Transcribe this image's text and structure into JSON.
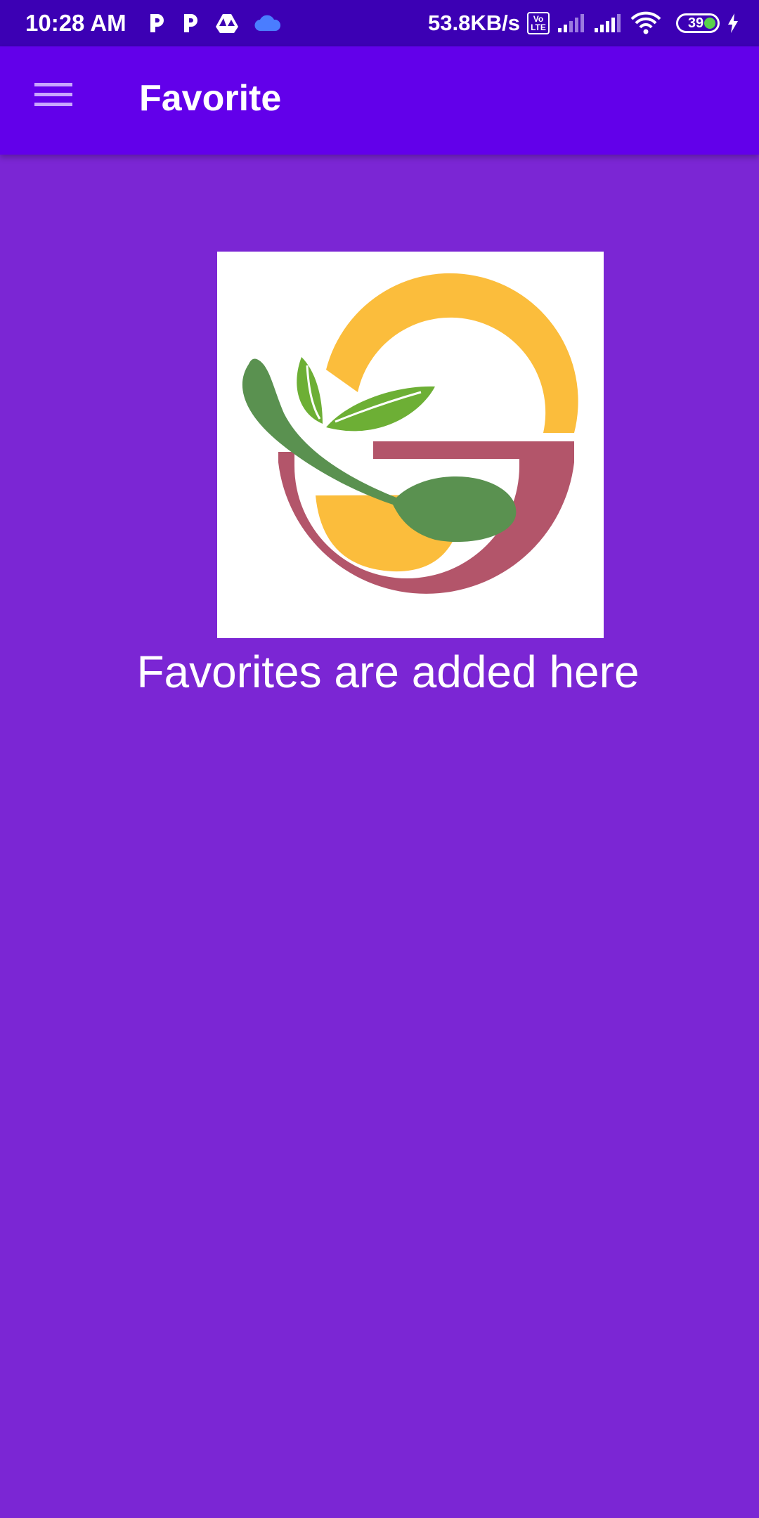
{
  "status_bar": {
    "time": "10:28 AM",
    "notification_icons": [
      "parking-p-icon",
      "parking-p-icon",
      "google-drive-icon",
      "cloud-icon"
    ],
    "network_speed": "53.8KB/s",
    "volte_badge": "Vo\nLTE",
    "battery_level": "39",
    "accent_colors": {
      "cloud": "#4a7dff",
      "battery_fill": "#59d24a"
    }
  },
  "app_bar": {
    "title": "Favorite",
    "menu_icon": "hamburger-menu-icon",
    "background": "#6200ea"
  },
  "main": {
    "background": "#7b26d4",
    "logo": {
      "icon": "food-bowl-spoon-logo",
      "colors": {
        "ring": "#fbbd3c",
        "bowl": "#b3556a",
        "spoon": "#5a9150",
        "leaf": "#6daf35"
      }
    },
    "empty_message": "Favorites are added here"
  }
}
